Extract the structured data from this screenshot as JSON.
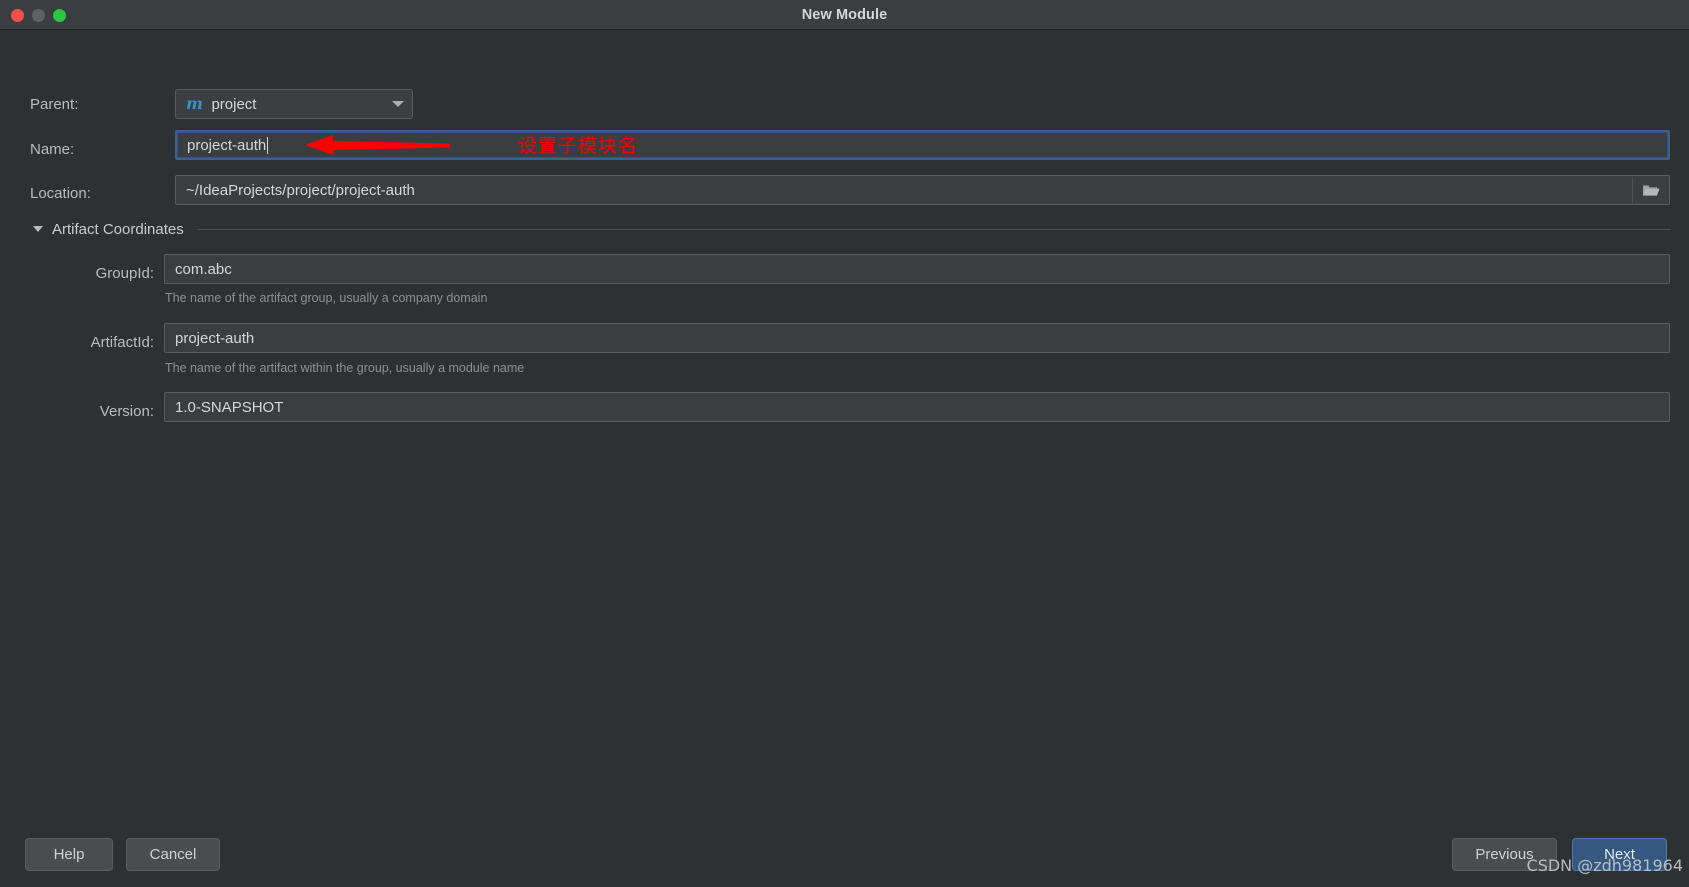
{
  "window": {
    "title": "New Module",
    "controls": {
      "close": "close-button",
      "minimize": "minimize-button",
      "maximize": "maximize-button"
    },
    "colors": {
      "background": "#2e3134",
      "titlebar": "#3b3e41",
      "field_background": "#3b3e40",
      "field_border": "#5a5d5f",
      "focus_border": "#3d6185",
      "primary_button": "#365880",
      "maven_icon": "#3592c4",
      "annotation_red": "#fe0000",
      "close_dot": "#f1514a",
      "minimize_dot": "#5e6164",
      "maximize_dot": "#28c840"
    }
  },
  "form": {
    "parent": {
      "label": "Parent:",
      "value": "project",
      "icon": "maven-module-icon"
    },
    "name": {
      "label": "Name:",
      "value": "project-auth",
      "focused": true
    },
    "location": {
      "label": "Location:",
      "value": "~/IdeaProjects/project/project-auth",
      "browse_icon": "folder-icon"
    }
  },
  "artifact_coordinates": {
    "section_label": "Artifact Coordinates",
    "expanded": true,
    "fields": [
      {
        "label": "GroupId:",
        "value": "com.abc",
        "hint": "The name of the artifact group, usually a company domain"
      },
      {
        "label": "ArtifactId:",
        "value": "project-auth",
        "hint": "The name of the artifact within the group, usually a module name"
      },
      {
        "label": "Version:",
        "value": "1.0-SNAPSHOT",
        "hint": ""
      }
    ]
  },
  "annotation": {
    "text": "设置子模块名",
    "arrow": "left-arrow-annotation"
  },
  "footer": {
    "help": "Help",
    "cancel": "Cancel",
    "previous": "Previous",
    "next": "Next"
  },
  "watermark": {
    "text": "CSDN @zdh981964"
  }
}
